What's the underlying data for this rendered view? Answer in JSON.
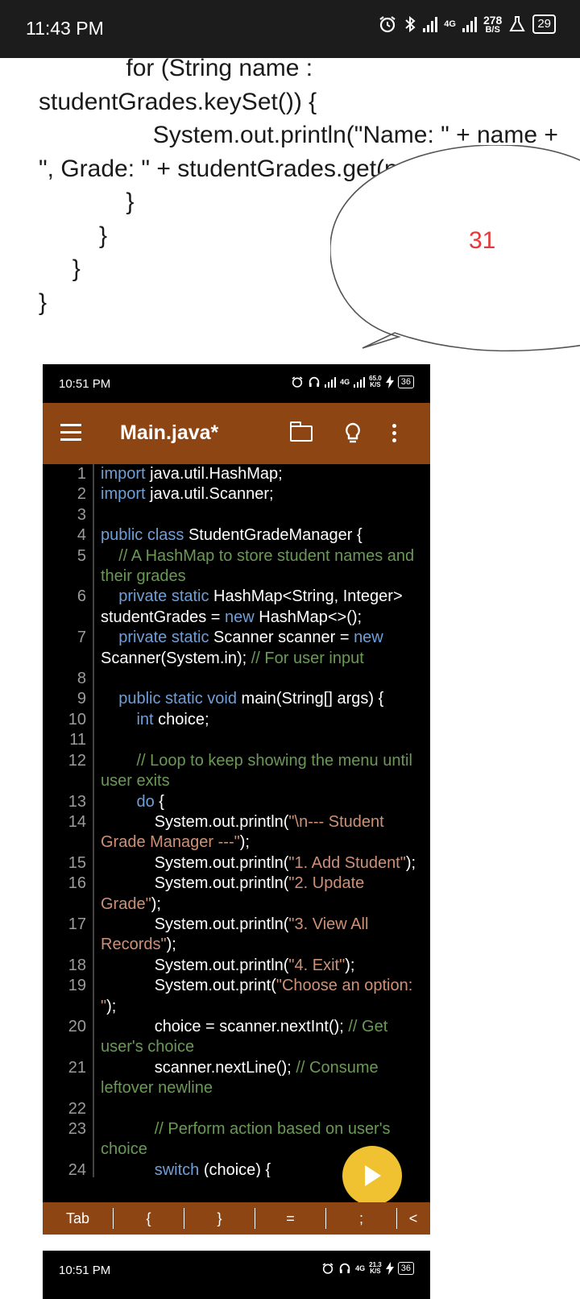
{
  "status_bar": {
    "time": "11:43 PM",
    "net_type": "4G",
    "speed_value": "278",
    "speed_unit": "B/S",
    "battery": "29"
  },
  "doc_code": [
    "             for (String name : studentGrades.keySet()) {",
    "                 System.out.println(\"Name: \" + name + \", Grade: \" + studentGrades.get(name));",
    "             }",
    "         }",
    "     }",
    "}"
  ],
  "bubble_number": "31",
  "phone": {
    "status_time": "10:51 PM",
    "net_type": "4G",
    "speed_value": "65.0",
    "speed_unit": "K/S",
    "battery": "36",
    "file_title": "Main.java*",
    "keys": [
      "Tab",
      "{",
      "}",
      "=",
      ";",
      "<"
    ],
    "code_lines": [
      {
        "n": "1",
        "segments": [
          [
            "kw",
            "import"
          ],
          [
            "pl",
            " java.util.HashMap;"
          ]
        ]
      },
      {
        "n": "2",
        "segments": [
          [
            "kw",
            "import"
          ],
          [
            "pl",
            " java.util.Scanner;"
          ]
        ]
      },
      {
        "n": "3",
        "segments": []
      },
      {
        "n": "4",
        "segments": [
          [
            "kw",
            "public class"
          ],
          [
            "pl",
            " StudentGradeManager {"
          ]
        ]
      },
      {
        "n": "5",
        "segments": [
          [
            "cm",
            "    // A HashMap to store student names and their grades"
          ]
        ]
      },
      {
        "n": "6",
        "segments": [
          [
            "kw",
            "    private static"
          ],
          [
            "pl",
            " HashMap<String, Integer> studentGrades = "
          ],
          [
            "kw",
            "new"
          ],
          [
            "pl",
            " HashMap<>();"
          ]
        ]
      },
      {
        "n": "7",
        "segments": [
          [
            "kw",
            "    private static"
          ],
          [
            "pl",
            " Scanner scanner = "
          ],
          [
            "kw",
            "new"
          ],
          [
            "pl",
            " Scanner(System.in); "
          ],
          [
            "cm",
            "// For user input"
          ]
        ]
      },
      {
        "n": "8",
        "segments": []
      },
      {
        "n": "9",
        "segments": [
          [
            "kw",
            "    public static void"
          ],
          [
            "pl",
            " main(String[] args) {"
          ]
        ]
      },
      {
        "n": "10",
        "segments": [
          [
            "kw",
            "        int"
          ],
          [
            "pl",
            " choice;"
          ]
        ]
      },
      {
        "n": "11",
        "segments": []
      },
      {
        "n": "12",
        "segments": [
          [
            "cm",
            "        // Loop to keep showing the menu until user exits"
          ]
        ]
      },
      {
        "n": "13",
        "segments": [
          [
            "kw",
            "        do"
          ],
          [
            "pl",
            " {"
          ]
        ]
      },
      {
        "n": "14",
        "segments": [
          [
            "pl",
            "            System.out.println("
          ],
          [
            "st",
            "\"\\n--- Student Grade Manager ---\""
          ],
          [
            "pl",
            ");"
          ]
        ]
      },
      {
        "n": "15",
        "segments": [
          [
            "pl",
            "            System.out.println("
          ],
          [
            "st",
            "\"1. Add Student\""
          ],
          [
            "pl",
            ");"
          ]
        ]
      },
      {
        "n": "16",
        "segments": [
          [
            "pl",
            "            System.out.println("
          ],
          [
            "st",
            "\"2. Update Grade\""
          ],
          [
            "pl",
            ");"
          ]
        ]
      },
      {
        "n": "17",
        "segments": [
          [
            "pl",
            "            System.out.println("
          ],
          [
            "st",
            "\"3. View All Records\""
          ],
          [
            "pl",
            ");"
          ]
        ]
      },
      {
        "n": "18",
        "segments": [
          [
            "pl",
            "            System.out.println("
          ],
          [
            "st",
            "\"4. Exit\""
          ],
          [
            "pl",
            ");"
          ]
        ]
      },
      {
        "n": "19",
        "segments": [
          [
            "pl",
            "            System.out.print("
          ],
          [
            "st",
            "\"Choose an option: \""
          ],
          [
            "pl",
            ");"
          ]
        ]
      },
      {
        "n": "20",
        "segments": [
          [
            "pl",
            "            choice = scanner.nextInt(); "
          ],
          [
            "cm",
            "// Get user's choice"
          ]
        ]
      },
      {
        "n": "21",
        "segments": [
          [
            "pl",
            "            scanner.nextLine(); "
          ],
          [
            "cm",
            "// Consume leftover newline"
          ]
        ]
      },
      {
        "n": "22",
        "segments": []
      },
      {
        "n": "23",
        "segments": [
          [
            "cm",
            "            // Perform action based on user's choice"
          ]
        ]
      },
      {
        "n": "24",
        "segments": [
          [
            "kw",
            "            switch"
          ],
          [
            "pl",
            " (choice) {"
          ]
        ]
      }
    ]
  },
  "phone2": {
    "status_time": "10:51 PM",
    "net_type": "4G",
    "speed_value": "21.3",
    "speed_unit": "K/S",
    "battery": "36"
  }
}
